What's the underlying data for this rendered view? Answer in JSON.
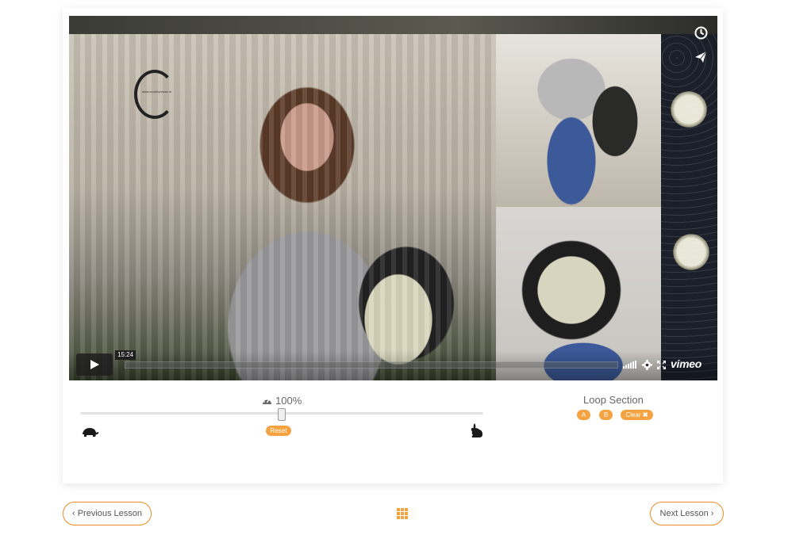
{
  "video": {
    "logo_text": "www.countrymusic.ie",
    "current_time_tooltip": "15:24",
    "brand": "vimeo",
    "icons": [
      "clock-icon",
      "paper-plane-icon",
      "play-icon",
      "volume-bars-icon",
      "gear-icon",
      "fullscreen-icon"
    ]
  },
  "speed": {
    "icon": "tachometer-icon",
    "value": "100%",
    "reset_label": "Reset",
    "slow_icon": "turtle-icon",
    "fast_icon": "rabbit-icon",
    "level_percent": 50
  },
  "loop": {
    "title": "Loop Section",
    "a_label": "A",
    "b_label": "B",
    "clear_label": "Clear",
    "clear_icon": "times-icon"
  },
  "nav": {
    "prev_label": "Previous Lesson",
    "next_label": "Next Lesson",
    "grid_icon": "grid-icon"
  },
  "colors": {
    "accent": "#f4a340",
    "button_border": "#f08a24",
    "video_controls_bg": "#1e1e1e"
  }
}
